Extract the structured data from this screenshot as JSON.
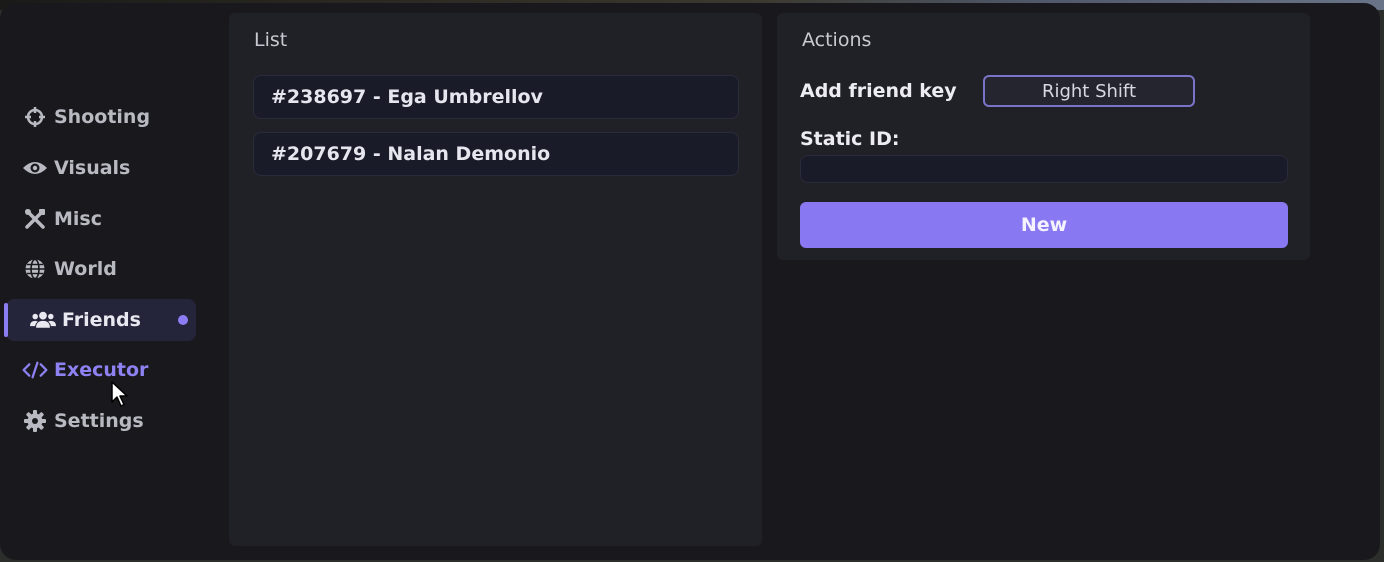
{
  "sidebar": {
    "items": [
      {
        "label": "Shooting",
        "icon": "crosshair-icon"
      },
      {
        "label": "Visuals",
        "icon": "eye-icon"
      },
      {
        "label": "Misc",
        "icon": "tools-icon"
      },
      {
        "label": "World",
        "icon": "globe-icon"
      },
      {
        "label": "Friends",
        "icon": "users-icon",
        "active": true
      },
      {
        "label": "Executor",
        "icon": "code-icon"
      },
      {
        "label": "Settings",
        "icon": "gear-icon"
      }
    ]
  },
  "list": {
    "title": "List",
    "entries": [
      "#238697 - Ega Umbrellov",
      "#207679 - Nalan Demonio"
    ]
  },
  "actions": {
    "title": "Actions",
    "add_friend_key_label": "Add friend key",
    "add_friend_key_value": "Right Shift",
    "static_id_label": "Static ID:",
    "static_id_value": "",
    "new_button_label": "New"
  },
  "colors": {
    "accent": "#8878f2",
    "window_bg": "#18181d",
    "panel_bg": "#202126"
  }
}
